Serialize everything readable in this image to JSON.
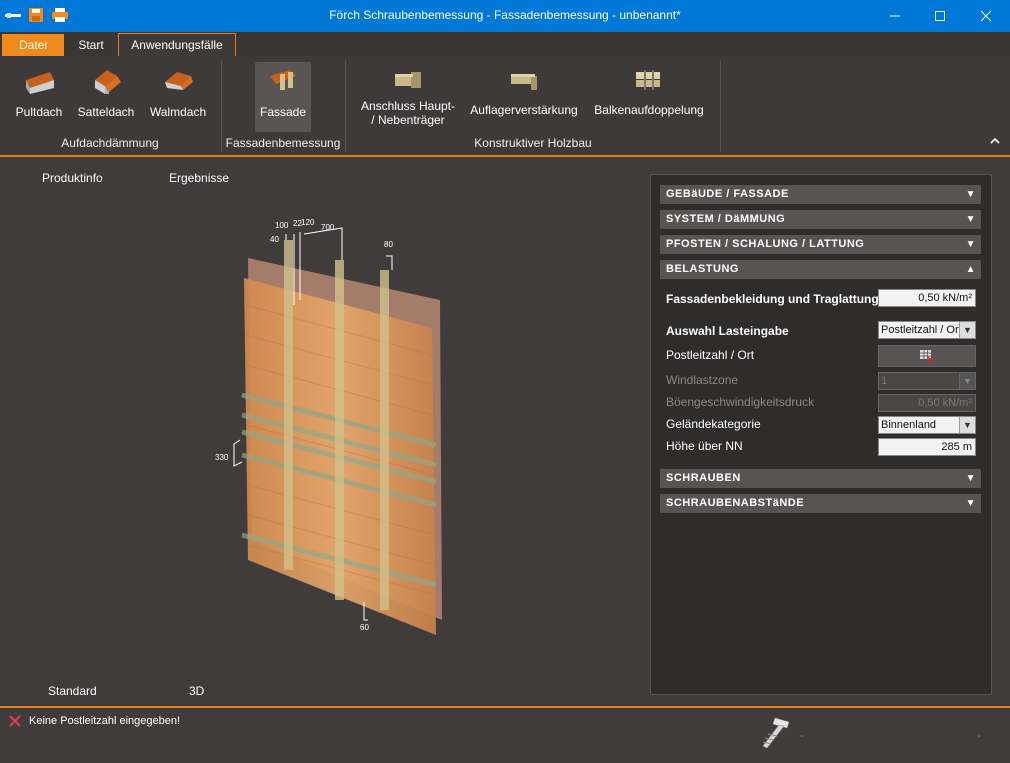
{
  "window": {
    "title": "Förch Schraubenbemessung - Fassadenbemessung - unbenannt*"
  },
  "tabs": {
    "datei": "Datei",
    "start": "Start",
    "anwendungsfaelle": "Anwendungsfälle"
  },
  "ribbon": {
    "pultdach": "Pultdach",
    "satteldach": "Satteldach",
    "walmdach": "Walmdach",
    "group_aufdach": "Aufdachdämmung",
    "fassade": "Fassade",
    "group_fassade": "Fassadenbemessung",
    "anschluss_line1": "Anschluss Haupt-",
    "anschluss_line2": "/ Nebenträger",
    "auflager": "Auflagerverstärkung",
    "balken": "Balkenaufdoppelung",
    "group_konstruktiv": "Konstruktiver Holzbau"
  },
  "view": {
    "produktinfo": "Produktinfo",
    "ergebnisse": "Ergebnisse",
    "standard": "Standard",
    "view3d": "3D",
    "dims": {
      "d100": "100",
      "d22": "22",
      "d120": "120",
      "d700": "700",
      "d40": "40",
      "d80": "80",
      "d330": "330",
      "d60": "60"
    }
  },
  "panel": {
    "sections": {
      "gebaeude": "GEBäUDE / FASSADE",
      "system": "SYSTEM / DäMMUNG",
      "pfosten": "PFOSTEN / SCHALUNG / LATTUNG",
      "belastung": "BELASTUNG",
      "schrauben": "SCHRAUBEN",
      "abstaende": "SCHRAUBENABSTäNDE"
    },
    "fassadenbekleidung_label": "Fassadenbekleidung und Traglattung",
    "fassadenbekleidung_value": "0,50 kN/m²",
    "auswahl_label": "Auswahl Lasteingabe",
    "auswahl_value": "Postleitzahl / Ort",
    "plz_label": "Postleitzahl / Ort",
    "windlastzone_label": "Windlastzone",
    "windlastzone_value": "1",
    "boeen_label": "Böengeschwindigkeitsdruck",
    "boeen_value": "0,50 kN/m²",
    "gelaende_label": "Geländekategorie",
    "gelaende_value": "Binnenland",
    "hoehe_label": "Höhe über NN",
    "hoehe_value": "285 m"
  },
  "status": {
    "error_text": "Keine Postleitzahl eingegeben!",
    "dash1": "-",
    "dash2": "-"
  },
  "colors": {
    "accent": "#e87b1a",
    "titlebar": "#0078d7",
    "background": "#403c3c"
  }
}
